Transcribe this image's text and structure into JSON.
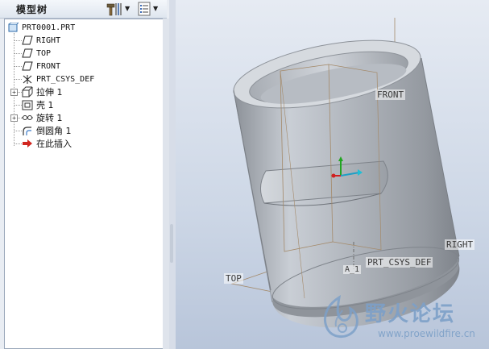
{
  "model_tree": {
    "title": "模型树",
    "settings_icon": "settings-hammer-icon",
    "show_icon": "show-list-icon",
    "nodes": [
      {
        "label": "PRT0001.PRT",
        "icon": "part-icon"
      },
      {
        "label": "RIGHT",
        "icon": "datum-plane-icon"
      },
      {
        "label": "TOP",
        "icon": "datum-plane-icon"
      },
      {
        "label": "FRONT",
        "icon": "datum-plane-icon"
      },
      {
        "label": "PRT_CSYS_DEF",
        "icon": "coordinate-system-icon"
      },
      {
        "label": "拉伸 1",
        "icon": "extrude-icon"
      },
      {
        "label": "壳 1",
        "icon": "shell-icon"
      },
      {
        "label": "旋转 1",
        "icon": "revolve-icon"
      },
      {
        "label": "倒圆角 1",
        "icon": "round-icon"
      },
      {
        "label": "在此插入",
        "icon": "insert-here-arrow-icon"
      }
    ]
  },
  "viewport": {
    "plane_labels": {
      "front": "FRONT",
      "right": "RIGHT",
      "top": "TOP",
      "csys": "PRT_CSYS_DEF"
    },
    "axis_label": "A_1",
    "model_color": "#b9bec5"
  },
  "watermark": {
    "title": "野火论坛",
    "url": "www.proewildfire.cn",
    "color": "#7da0c8"
  }
}
